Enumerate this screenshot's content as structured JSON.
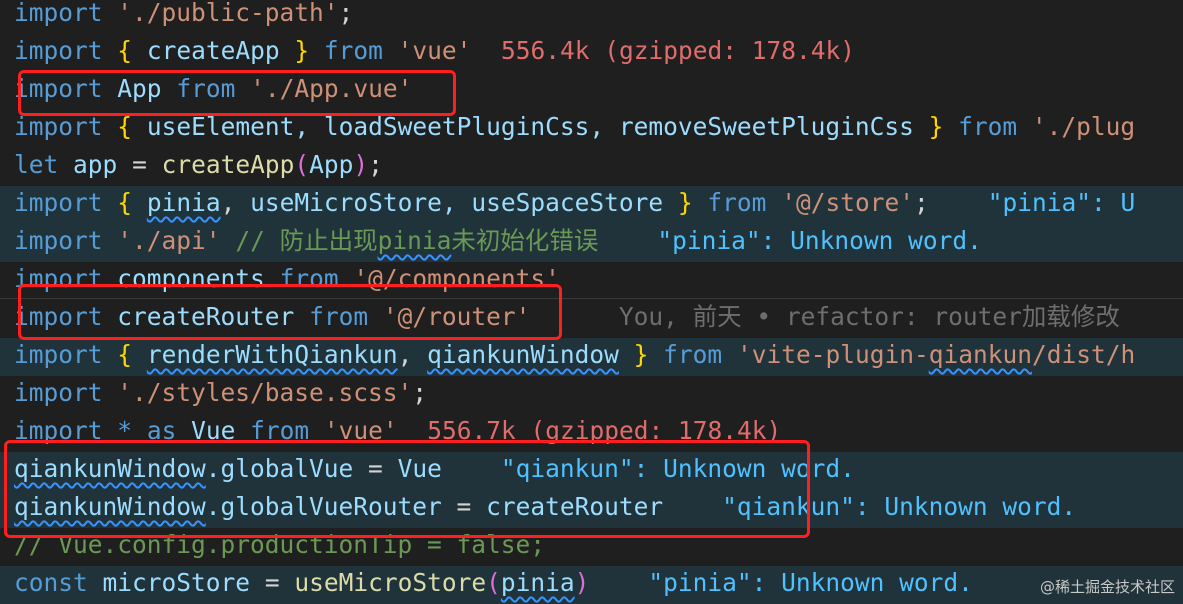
{
  "colors": {
    "background": "#1f1f1f",
    "highlight": "#20323a",
    "keyword": "#569cd6",
    "string": "#ce9178",
    "comment": "#6a9955",
    "box": "#ff1f1f"
  },
  "lines": [
    {
      "kw": "import",
      "str": "'./public-path'",
      "end": ";"
    },
    {
      "kw": "import",
      "open": "{",
      "name": "createApp",
      "close": "}",
      "from": "from",
      "str": "'vue'",
      "size": "556.4k (gzipped: 178.4k)"
    },
    {
      "kw": "import",
      "name": "App",
      "from": "from",
      "str": "'./App.vue'"
    },
    {
      "kw": "import",
      "open": "{",
      "names": "useElement, loadSweetPluginCss, removeSweetPluginCss",
      "close": "}",
      "from": "from",
      "str": "'./plug"
    },
    {
      "kw": "let",
      "name": "app",
      "eq": "=",
      "fn": "createApp",
      "open": "(",
      "arg": "App",
      "close": ")",
      "end": ";"
    },
    {
      "kw": "import",
      "open": "{",
      "n1": "pinia",
      "sep": ",",
      "names": "useMicroStore, useSpaceStore",
      "close": "}",
      "from": "from",
      "str": "'@/store'",
      "end": ";",
      "diag": "\"pinia\": U"
    },
    {
      "kw": "import",
      "str": "'./api'",
      "cmt1": "// 防止出现",
      "cmt2": "pinia",
      "cmt3": "未初始化错误",
      "diag": "\"pinia\": Unknown word."
    },
    {
      "kw": "import",
      "name": "components",
      "from": "from",
      "str": "'@/components'"
    },
    {
      "kw": "import",
      "name": "createRouter",
      "from": "from",
      "str": "'@/router'",
      "blame": "You, 前天 • refactor: router加载修改"
    },
    {
      "kw": "import",
      "open": "{",
      "n1": "renderWithQiankun",
      "sep": ",",
      "n2": "qiankunWindow",
      "close": "}",
      "from": "from",
      "str1": "'vite-plugin-",
      "str2": "qiankun",
      "str3": "/dist/h"
    },
    {
      "kw": "import",
      "str": "'./styles/base.scss'",
      "end": ";"
    },
    {
      "kw": "import",
      "star": "*",
      "as": "as",
      "name": "Vue",
      "from": "from",
      "str": "'vue'",
      "size": "556.7k (gzipped: 178.4k)"
    },
    {
      "obj": "qiankunWindow",
      "prop": ".globalVue",
      "eq": "=",
      "val": "Vue",
      "diag": "\"qiankun\": Unknown word."
    },
    {
      "obj": "qiankunWindow",
      "prop": ".globalVueRouter",
      "eq": "=",
      "val": "createRouter",
      "diag": "\"qiankun\": Unknown word."
    },
    {
      "cmt": "// Vue.config.productionTip = false;"
    },
    {
      "kw": "const",
      "name": "microStore",
      "eq": "=",
      "fn": "useMicroStore",
      "open": "(",
      "arg": "pinia",
      "close": ")",
      "diag": "\"pinia\": Unknown word."
    }
  ],
  "watermark": "@稀土掘金技术社区"
}
